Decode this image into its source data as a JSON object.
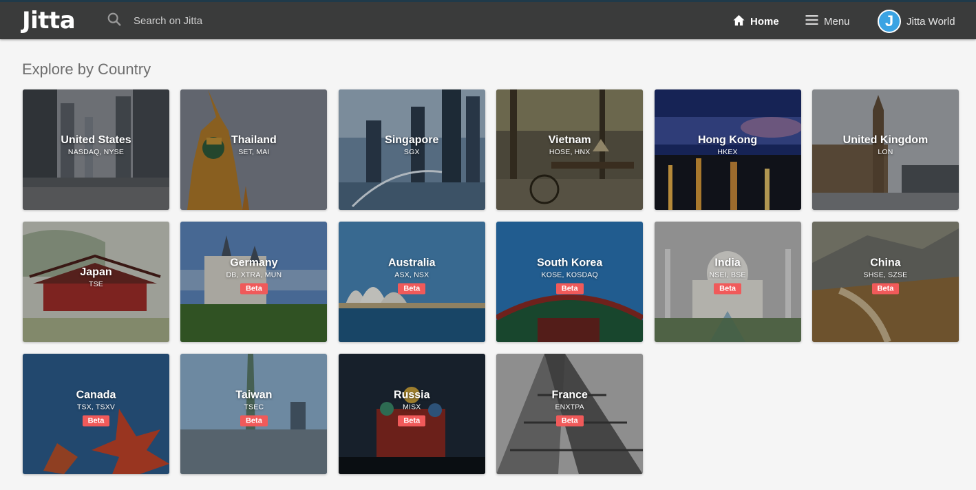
{
  "header": {
    "logo": "Jitta",
    "search_placeholder": "Search on Jitta",
    "home_label": "Home",
    "menu_label": "Menu",
    "user_label": "Jitta World",
    "avatar_letter": "J"
  },
  "page_title": "Explore by Country",
  "beta_label": "Beta",
  "countries": [
    {
      "name": "United States",
      "exchanges": "NASDAQ, NYSE",
      "beta": false,
      "theme": "city"
    },
    {
      "name": "Thailand",
      "exchanges": "SET, MAI",
      "beta": false,
      "theme": "thai"
    },
    {
      "name": "Singapore",
      "exchanges": "SGX",
      "beta": false,
      "theme": "sg"
    },
    {
      "name": "Vietnam",
      "exchanges": "HOSE, HNX",
      "beta": false,
      "theme": "vn"
    },
    {
      "name": "Hong Kong",
      "exchanges": "HKEX",
      "beta": false,
      "theme": "hk"
    },
    {
      "name": "United Kingdom",
      "exchanges": "LON",
      "beta": false,
      "theme": "uk"
    },
    {
      "name": "Japan",
      "exchanges": "TSE",
      "beta": false,
      "theme": "jp"
    },
    {
      "name": "Germany",
      "exchanges": "DB, XTRA, MUN",
      "beta": true,
      "theme": "de"
    },
    {
      "name": "Australia",
      "exchanges": "ASX, NSX",
      "beta": true,
      "theme": "au"
    },
    {
      "name": "South Korea",
      "exchanges": "KOSE, KOSDAQ",
      "beta": true,
      "theme": "kr"
    },
    {
      "name": "India",
      "exchanges": "NSEI, BSE",
      "beta": true,
      "theme": "in"
    },
    {
      "name": "China",
      "exchanges": "SHSE, SZSE",
      "beta": true,
      "theme": "cn"
    },
    {
      "name": "Canada",
      "exchanges": "TSX, TSXV",
      "beta": true,
      "theme": "ca"
    },
    {
      "name": "Taiwan",
      "exchanges": "TSEC",
      "beta": true,
      "theme": "tw"
    },
    {
      "name": "Russia",
      "exchanges": "MISX",
      "beta": true,
      "theme": "ru"
    },
    {
      "name": "France",
      "exchanges": "ENXTPA",
      "beta": true,
      "theme": "fr"
    }
  ]
}
